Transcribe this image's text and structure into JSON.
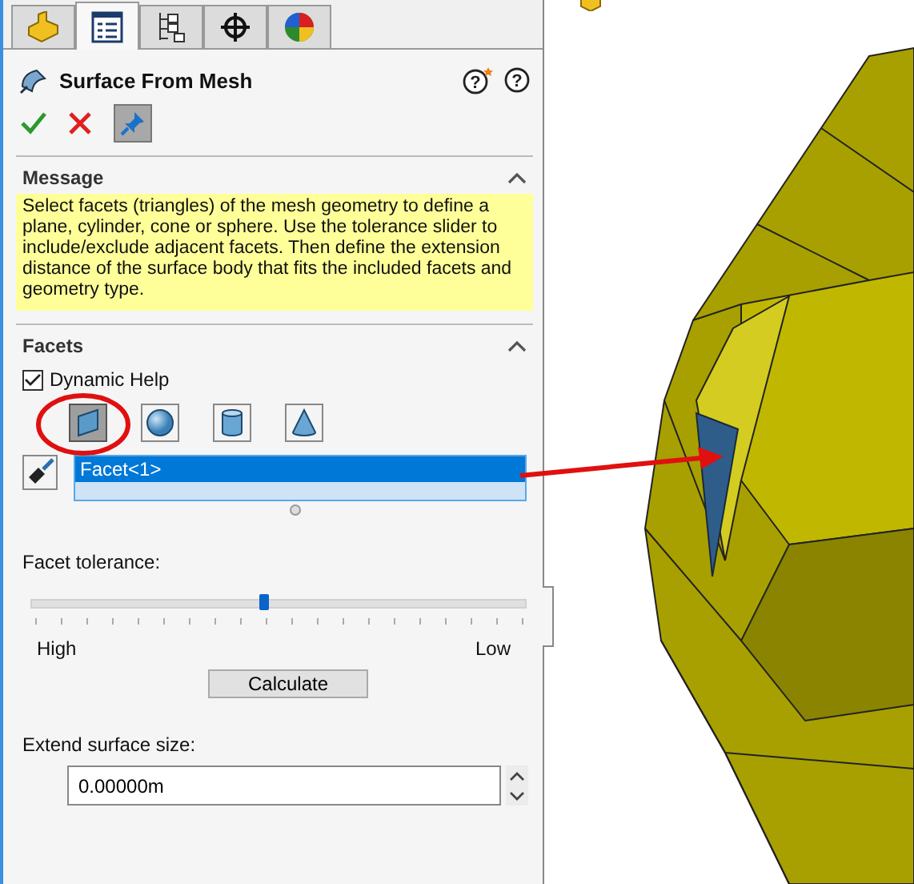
{
  "tabs": [
    {
      "kind": "part",
      "selected": false
    },
    {
      "kind": "properties",
      "selected": true
    },
    {
      "kind": "configurations",
      "selected": false
    },
    {
      "kind": "dimxpert",
      "selected": false
    },
    {
      "kind": "appearance",
      "selected": false
    }
  ],
  "feature": {
    "title": "Surface From Mesh",
    "pin_selected": true,
    "help_buttons": [
      "?",
      "?"
    ]
  },
  "message": {
    "heading": "Message",
    "expanded": true,
    "text": "Select facets (triangles) of the mesh geometry to define a plane, cylinder, cone or sphere.  Use the tolerance slider to include/exclude adjacent facets.  Then define the extension distance of the surface body that fits the included facets and geometry type."
  },
  "facets": {
    "heading": "Facets",
    "expanded": true,
    "dynamic_help": {
      "label": "Dynamic Help",
      "checked": true
    },
    "geometry_types": [
      {
        "kind": "plane",
        "selected": true
      },
      {
        "kind": "sphere",
        "selected": false
      },
      {
        "kind": "cylinder",
        "selected": false
      },
      {
        "kind": "cone",
        "selected": false
      }
    ],
    "selection": [
      {
        "label": "Facet<1>",
        "selected": true
      }
    ],
    "tolerance": {
      "label": "Facet tolerance:",
      "level": 0.47,
      "min_label": "High",
      "max_label": "Low"
    },
    "calculate_button": "Calculate",
    "extend": {
      "label": "Extend surface size:",
      "value": "0.00000m"
    }
  }
}
